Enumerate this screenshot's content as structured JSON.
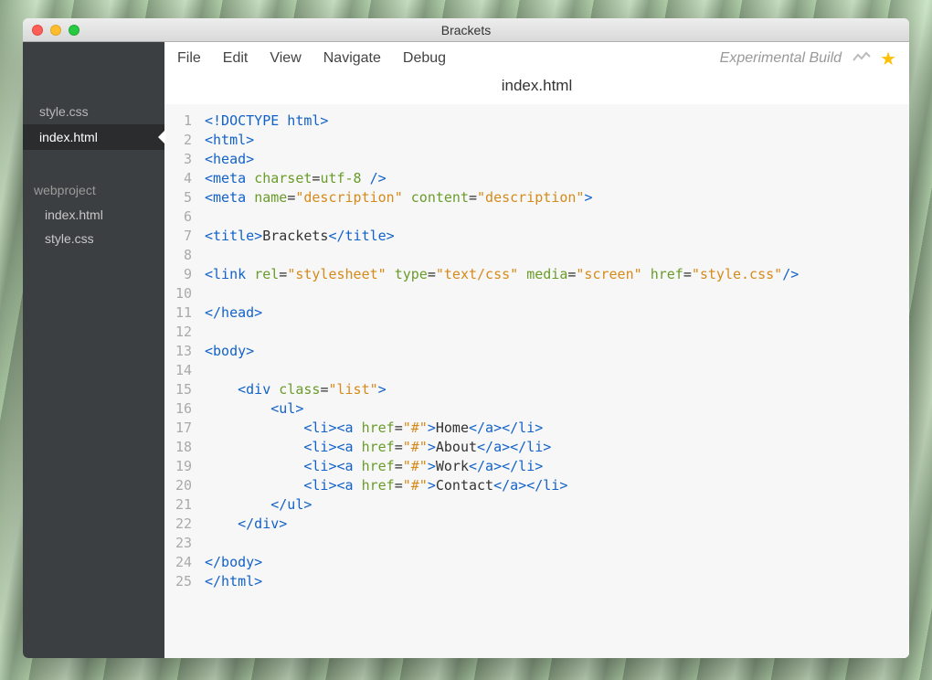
{
  "window": {
    "title": "Brackets"
  },
  "menu": {
    "items": [
      "File",
      "Edit",
      "View",
      "Navigate",
      "Debug"
    ],
    "experimental": "Experimental Build"
  },
  "sidebar": {
    "open_files": [
      {
        "name": "style.css",
        "active": false
      },
      {
        "name": "index.html",
        "active": true
      }
    ],
    "project_name": "webproject",
    "project_files": [
      "index.html",
      "style.css"
    ]
  },
  "current_file": "index.html",
  "code_lines": [
    [
      [
        "tag",
        "<!DOCTYPE html>"
      ]
    ],
    [
      [
        "tag",
        "<html>"
      ]
    ],
    [
      [
        "tag",
        "<head>"
      ]
    ],
    [
      [
        "tag",
        "<meta"
      ],
      [
        "text",
        " "
      ],
      [
        "attr",
        "charset"
      ],
      [
        "text",
        "="
      ],
      [
        "attr",
        "utf-8"
      ],
      [
        "text",
        " "
      ],
      [
        "tag",
        "/>"
      ]
    ],
    [
      [
        "tag",
        "<meta"
      ],
      [
        "text",
        " "
      ],
      [
        "attr",
        "name"
      ],
      [
        "text",
        "="
      ],
      [
        "str",
        "\"description\""
      ],
      [
        "text",
        " "
      ],
      [
        "attr",
        "content"
      ],
      [
        "text",
        "="
      ],
      [
        "str",
        "\"description\""
      ],
      [
        "tag",
        ">"
      ]
    ],
    [],
    [
      [
        "tag",
        "<title>"
      ],
      [
        "text",
        "Brackets"
      ],
      [
        "tag",
        "</title>"
      ]
    ],
    [],
    [
      [
        "tag",
        "<link"
      ],
      [
        "text",
        " "
      ],
      [
        "attr",
        "rel"
      ],
      [
        "text",
        "="
      ],
      [
        "str",
        "\"stylesheet\""
      ],
      [
        "text",
        " "
      ],
      [
        "attr",
        "type"
      ],
      [
        "text",
        "="
      ],
      [
        "str",
        "\"text/css\""
      ],
      [
        "text",
        " "
      ],
      [
        "attr",
        "media"
      ],
      [
        "text",
        "="
      ],
      [
        "str",
        "\"screen\""
      ],
      [
        "text",
        " "
      ],
      [
        "attr",
        "href"
      ],
      [
        "text",
        "="
      ],
      [
        "str",
        "\"style.css\""
      ],
      [
        "tag",
        "/>"
      ]
    ],
    [],
    [
      [
        "tag",
        "</head>"
      ]
    ],
    [],
    [
      [
        "tag",
        "<body>"
      ]
    ],
    [],
    [
      [
        "text",
        "    "
      ],
      [
        "tag",
        "<div"
      ],
      [
        "text",
        " "
      ],
      [
        "attr",
        "class"
      ],
      [
        "text",
        "="
      ],
      [
        "str",
        "\"list\""
      ],
      [
        "tag",
        ">"
      ]
    ],
    [
      [
        "text",
        "        "
      ],
      [
        "tag",
        "<ul>"
      ]
    ],
    [
      [
        "text",
        "            "
      ],
      [
        "tag",
        "<li><a"
      ],
      [
        "text",
        " "
      ],
      [
        "attr",
        "href"
      ],
      [
        "text",
        "="
      ],
      [
        "str",
        "\"#\""
      ],
      [
        "tag",
        ">"
      ],
      [
        "text",
        "Home"
      ],
      [
        "tag",
        "</a></li>"
      ]
    ],
    [
      [
        "text",
        "            "
      ],
      [
        "tag",
        "<li><a"
      ],
      [
        "text",
        " "
      ],
      [
        "attr",
        "href"
      ],
      [
        "text",
        "="
      ],
      [
        "str",
        "\"#\""
      ],
      [
        "tag",
        ">"
      ],
      [
        "text",
        "About"
      ],
      [
        "tag",
        "</a></li>"
      ]
    ],
    [
      [
        "text",
        "            "
      ],
      [
        "tag",
        "<li><a"
      ],
      [
        "text",
        " "
      ],
      [
        "attr",
        "href"
      ],
      [
        "text",
        "="
      ],
      [
        "str",
        "\"#\""
      ],
      [
        "tag",
        ">"
      ],
      [
        "text",
        "Work"
      ],
      [
        "tag",
        "</a></li>"
      ]
    ],
    [
      [
        "text",
        "            "
      ],
      [
        "tag",
        "<li><a"
      ],
      [
        "text",
        " "
      ],
      [
        "attr",
        "href"
      ],
      [
        "text",
        "="
      ],
      [
        "str",
        "\"#\""
      ],
      [
        "tag",
        ">"
      ],
      [
        "text",
        "Contact"
      ],
      [
        "tag",
        "</a></li>"
      ]
    ],
    [
      [
        "text",
        "        "
      ],
      [
        "tag",
        "</ul>"
      ]
    ],
    [
      [
        "text",
        "    "
      ],
      [
        "tag",
        "</div>"
      ]
    ],
    [],
    [
      [
        "tag",
        "</body>"
      ]
    ],
    [
      [
        "tag",
        "</html>"
      ]
    ]
  ]
}
